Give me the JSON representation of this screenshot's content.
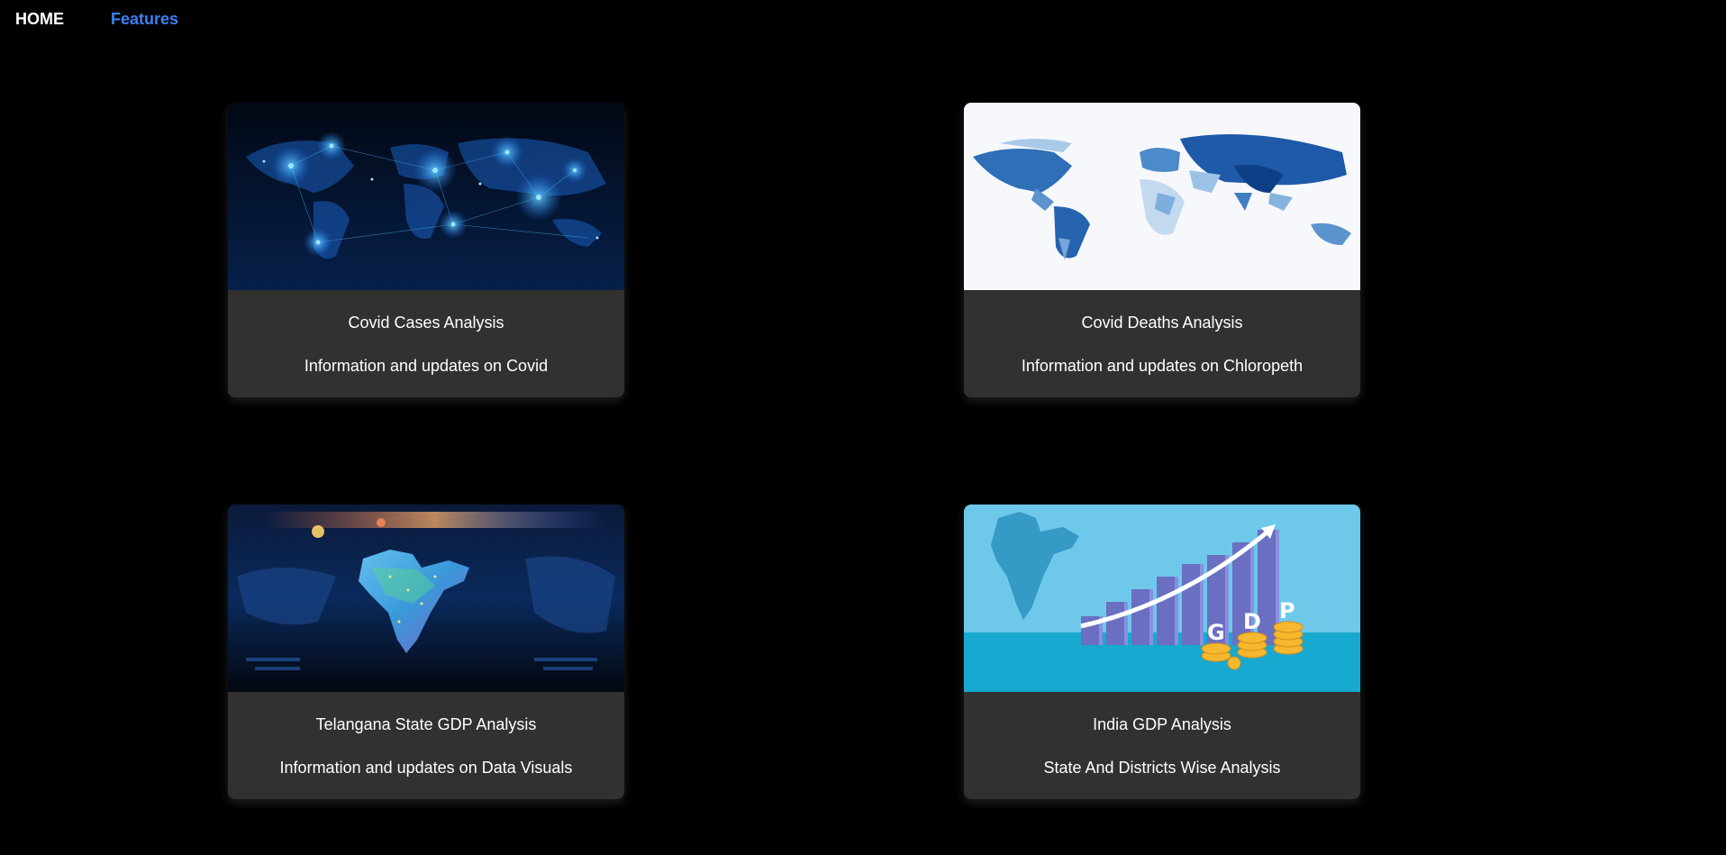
{
  "nav": {
    "home_label": "HOME",
    "features_label": "Features",
    "features_color": "#3b82f6"
  },
  "cards": [
    {
      "title": "Covid Cases Analysis",
      "description": "Information and updates on Covid",
      "image": "covid-network-world-map-image"
    },
    {
      "title": "Covid Deaths Analysis",
      "description": "Information and updates on Chloropeth",
      "image": "choropleth-world-map-image"
    },
    {
      "title": "Telangana State GDP Analysis",
      "description": "Information and updates on Data Visuals",
      "image": "india-digital-map-image"
    },
    {
      "title": "India GDP Analysis",
      "description": "State And Districts Wise Analysis",
      "image": "india-gdp-growth-illustration"
    }
  ],
  "colors": {
    "background": "#000000",
    "card_background": "#323130",
    "text": "#ffffff"
  }
}
